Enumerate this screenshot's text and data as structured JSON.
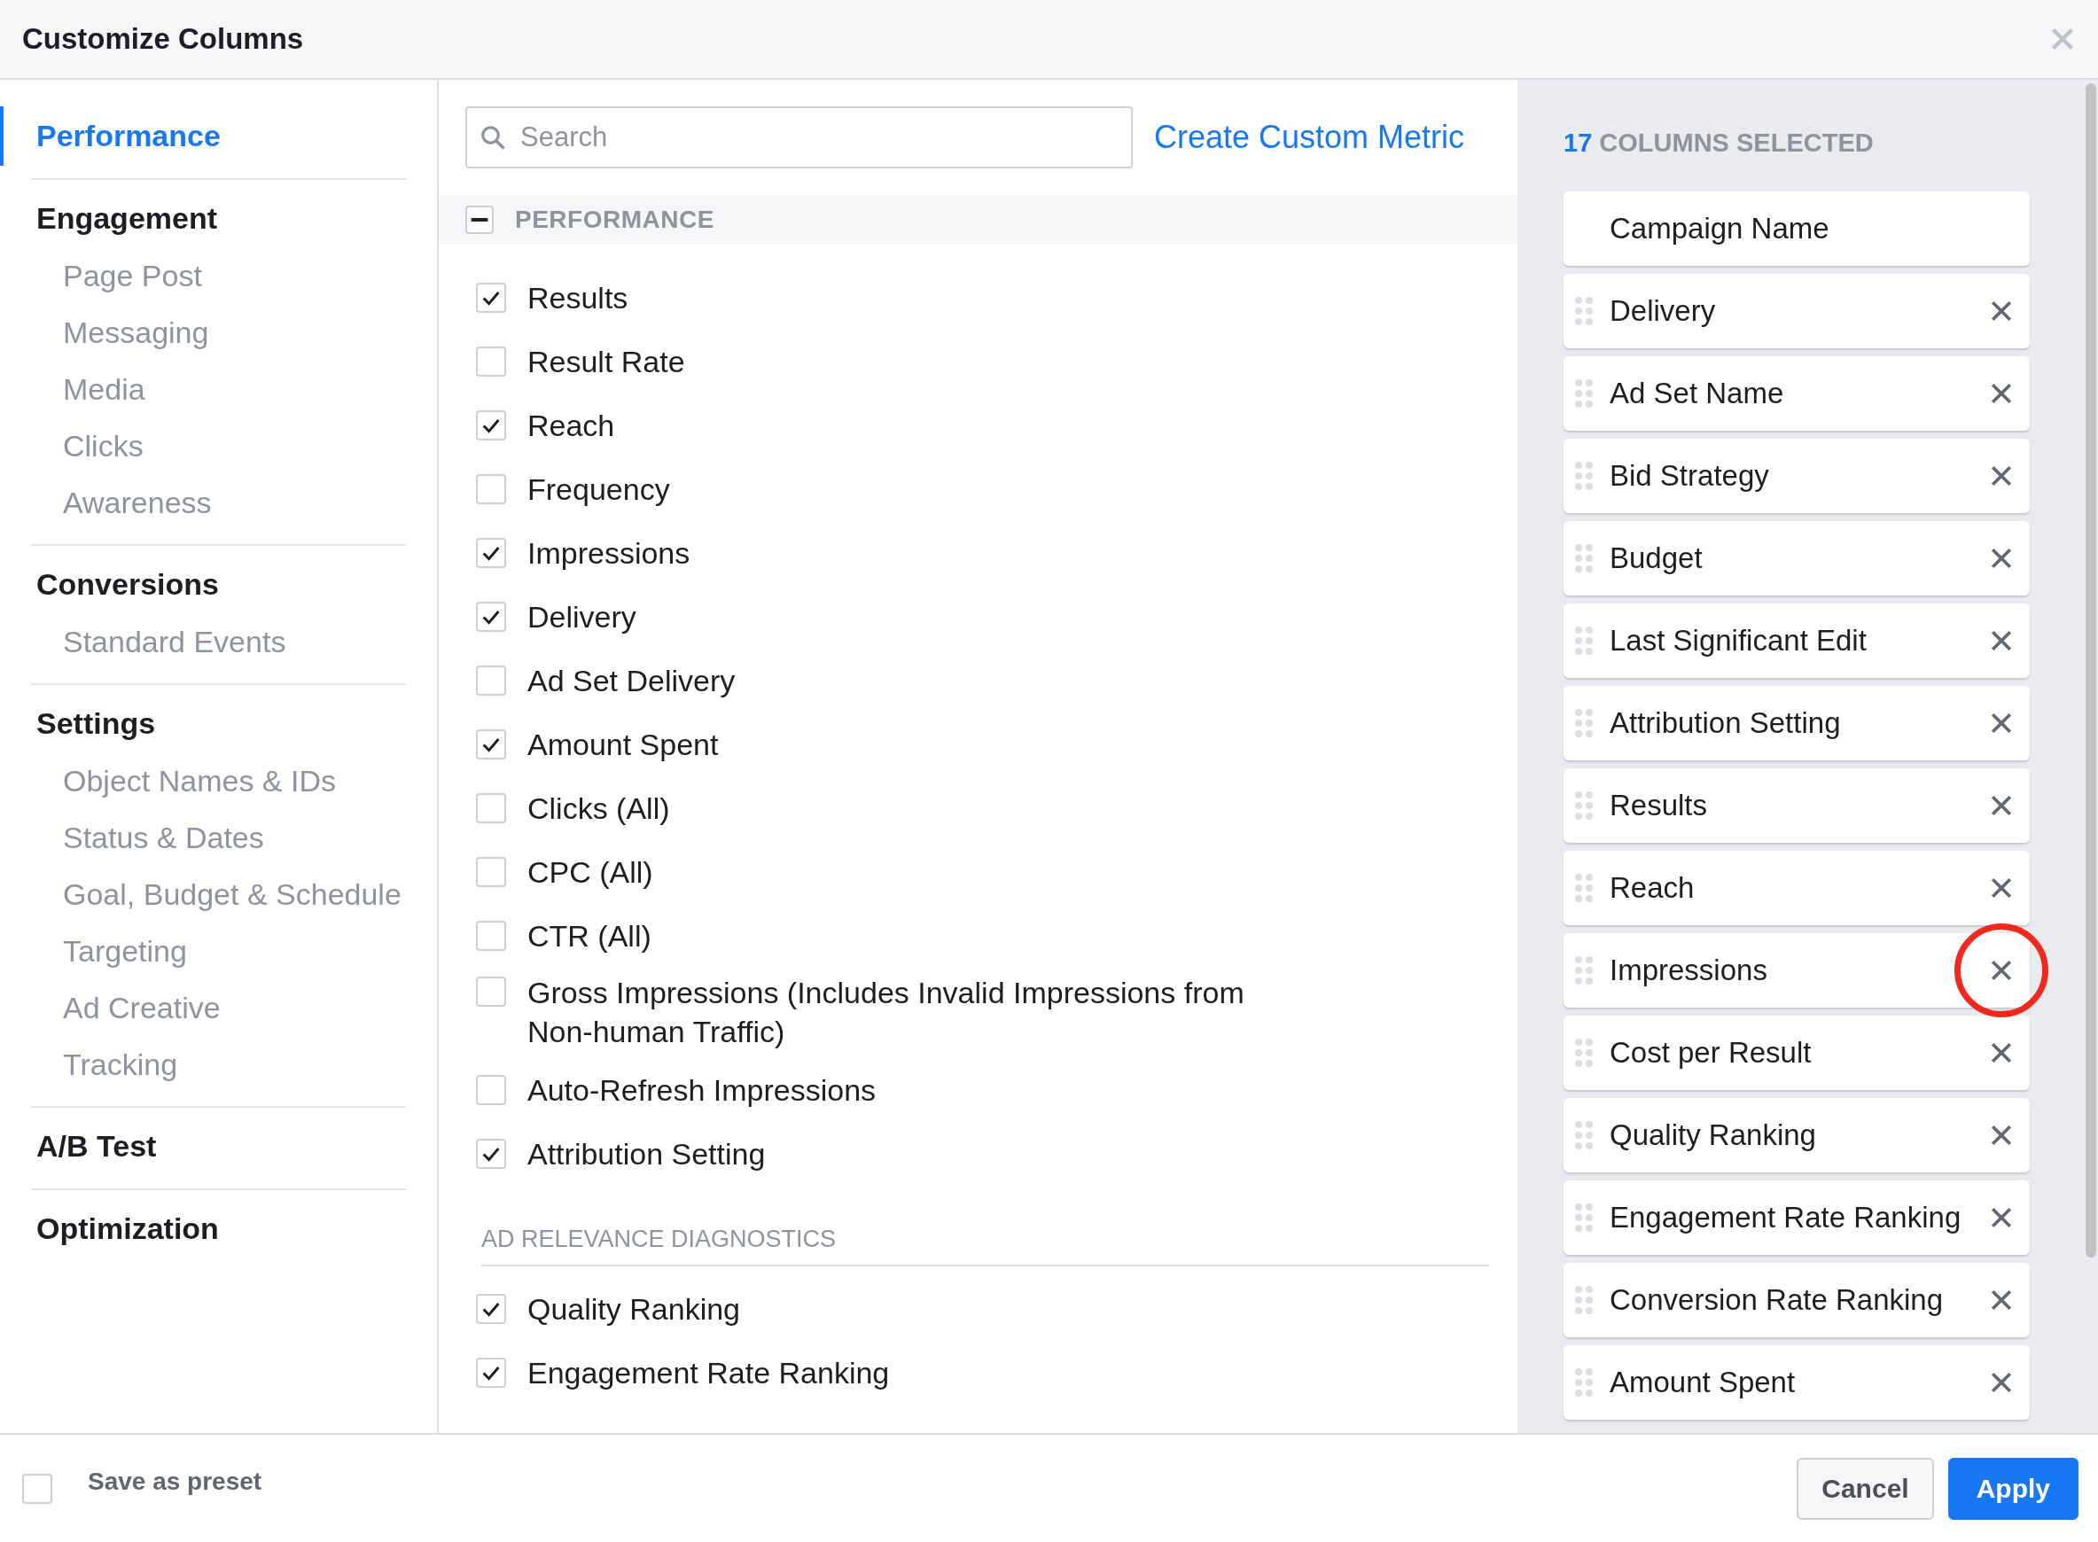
{
  "window": {
    "title": "Customize Columns"
  },
  "sidebar": {
    "groups": [
      {
        "label": "Performance",
        "selected": true
      },
      {
        "label": "Engagement",
        "selected": false,
        "children": [
          {
            "label": "Page Post"
          },
          {
            "label": "Messaging"
          },
          {
            "label": "Media"
          },
          {
            "label": "Clicks"
          },
          {
            "label": "Awareness"
          }
        ]
      },
      {
        "label": "Conversions",
        "selected": false,
        "children": [
          {
            "label": "Standard Events"
          }
        ]
      },
      {
        "label": "Settings",
        "selected": false,
        "children": [
          {
            "label": "Object Names & IDs"
          },
          {
            "label": "Status & Dates"
          },
          {
            "label": "Goal, Budget & Schedule"
          },
          {
            "label": "Targeting"
          },
          {
            "label": "Ad Creative"
          },
          {
            "label": "Tracking"
          }
        ]
      },
      {
        "label": "A/B Test",
        "selected": false
      },
      {
        "label": "Optimization",
        "selected": false
      }
    ]
  },
  "search": {
    "placeholder": "Search"
  },
  "create_link": "Create Custom Metric",
  "sections": [
    {
      "kind": "group",
      "title": "PERFORMANCE",
      "expanded": true,
      "items": [
        {
          "label": "Results",
          "checked": true
        },
        {
          "label": "Result Rate",
          "checked": false
        },
        {
          "label": "Reach",
          "checked": true
        },
        {
          "label": "Frequency",
          "checked": false
        },
        {
          "label": "Impressions",
          "checked": true
        },
        {
          "label": "Delivery",
          "checked": true
        },
        {
          "label": "Ad Set Delivery",
          "checked": false
        },
        {
          "label": "Amount Spent",
          "checked": true
        },
        {
          "label": "Clicks (All)",
          "checked": false
        },
        {
          "label": "CPC (All)",
          "checked": false
        },
        {
          "label": "CTR (All)",
          "checked": false
        },
        {
          "label": "Gross Impressions (Includes Invalid Impressions from Non-human Traffic)",
          "checked": false
        },
        {
          "label": "Auto-Refresh Impressions",
          "checked": false
        },
        {
          "label": "Attribution Setting",
          "checked": true
        }
      ]
    },
    {
      "kind": "subgroup",
      "title": "AD RELEVANCE DIAGNOSTICS",
      "items": [
        {
          "label": "Quality Ranking",
          "checked": true
        },
        {
          "label": "Engagement Rate Ranking",
          "checked": true
        }
      ]
    }
  ],
  "selected_panel": {
    "count": "17",
    "heading": "COLUMNS SELECTED",
    "columns": [
      {
        "label": "Campaign Name",
        "removable": false,
        "highlighted": false
      },
      {
        "label": "Delivery",
        "removable": true,
        "highlighted": false
      },
      {
        "label": "Ad Set Name",
        "removable": true,
        "highlighted": false
      },
      {
        "label": "Bid Strategy",
        "removable": true,
        "highlighted": false
      },
      {
        "label": "Budget",
        "removable": true,
        "highlighted": false
      },
      {
        "label": "Last Significant Edit",
        "removable": true,
        "highlighted": false
      },
      {
        "label": "Attribution Setting",
        "removable": true,
        "highlighted": false
      },
      {
        "label": "Results",
        "removable": true,
        "highlighted": false
      },
      {
        "label": "Reach",
        "removable": true,
        "highlighted": false
      },
      {
        "label": "Impressions",
        "removable": true,
        "highlighted": true
      },
      {
        "label": "Cost per Result",
        "removable": true,
        "highlighted": false
      },
      {
        "label": "Quality Ranking",
        "removable": true,
        "highlighted": false
      },
      {
        "label": "Engagement Rate Ranking",
        "removable": true,
        "highlighted": false
      },
      {
        "label": "Conversion Rate Ranking",
        "removable": true,
        "highlighted": false
      },
      {
        "label": "Amount Spent",
        "removable": true,
        "highlighted": false
      }
    ]
  },
  "footer": {
    "save_preset": {
      "label": "Save as preset",
      "checked": false
    },
    "buttons": [
      {
        "label": "Cancel",
        "kind": "secondary"
      },
      {
        "label": "Apply",
        "kind": "primary"
      }
    ]
  }
}
